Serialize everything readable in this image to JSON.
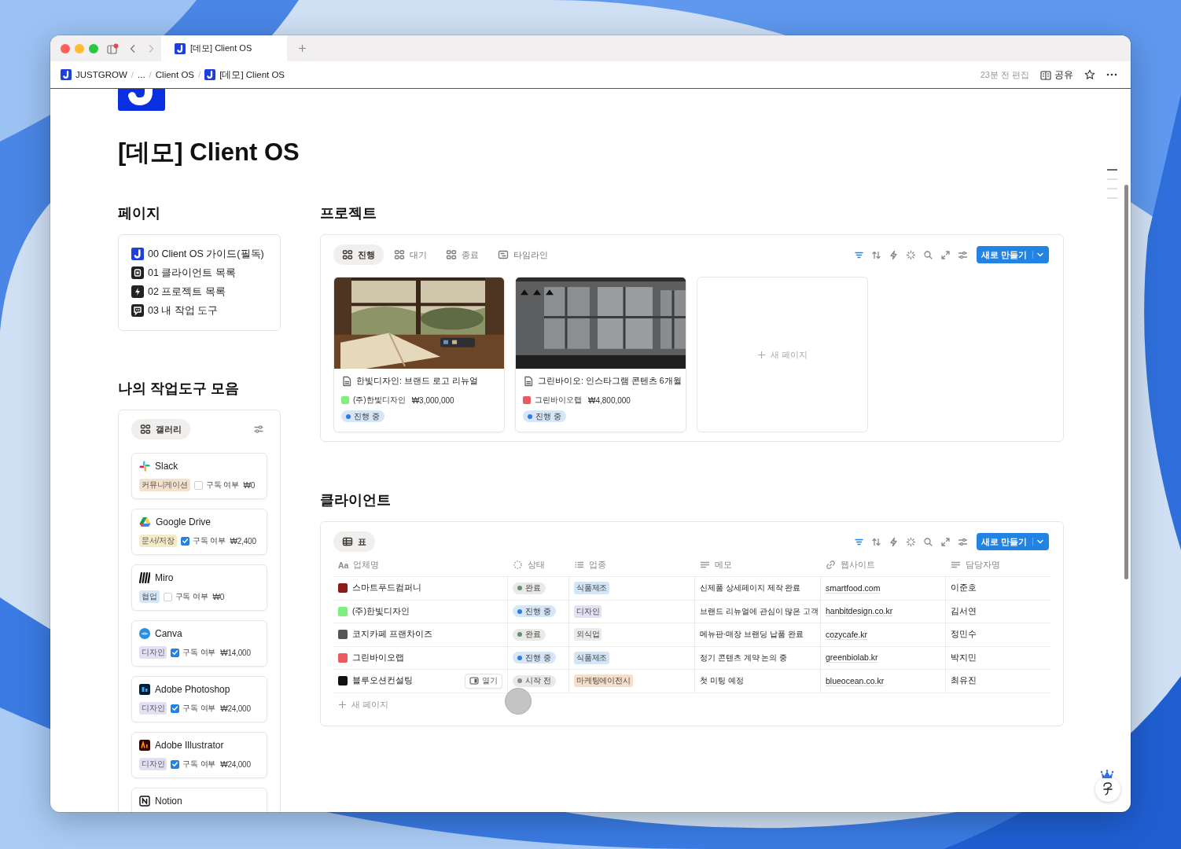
{
  "browser": {
    "tab_title": "[데모] Client OS"
  },
  "breadcrumbs": [
    {
      "label": "JUSTGROW",
      "kind": "logo"
    },
    {
      "label": "...",
      "kind": "text"
    },
    {
      "label": "Client OS",
      "kind": "text"
    },
    {
      "label": "[데모] Client OS",
      "kind": "logo"
    }
  ],
  "breadcrumb_separator": "/",
  "page_actions": {
    "edited": "23분 전 편집",
    "share": "공유"
  },
  "page": {
    "title": "[데모] Client OS"
  },
  "pages_section": {
    "heading": "페이지",
    "items": [
      {
        "label": "00 Client OS 가이드(필독)",
        "kind": "logo"
      },
      {
        "label": "01 클라이언트 목록",
        "kind": "copy"
      },
      {
        "label": "02 프로젝트 목록",
        "kind": "bolt"
      },
      {
        "label": "03 내 작업 도구",
        "kind": "chat"
      }
    ]
  },
  "tools_section": {
    "heading": "나의 작업도구 모음",
    "view_tab": "갤러리",
    "cards": [
      {
        "name": "Slack",
        "kind": "slack",
        "tag": "커뮤니케이션",
        "color": "#f4e1cc",
        "checked": false,
        "checkbox_label": "구독 여부",
        "price": "₩0"
      },
      {
        "name": "Google Drive",
        "kind": "gdrive",
        "tag": "문서/저장",
        "color": "#f5ebc9",
        "checked": true,
        "checkbox_label": "구독 여부",
        "price": "₩2,400"
      },
      {
        "name": "Miro",
        "kind": "miro",
        "tag": "협업",
        "color": "#d5e7f7",
        "checked": false,
        "checkbox_label": "구독 여부",
        "price": "₩0"
      },
      {
        "name": "Canva",
        "kind": "canva",
        "tag": "디자인",
        "color": "#e3e0f3",
        "checked": true,
        "checkbox_label": "구독 여부",
        "price": "₩14,000"
      },
      {
        "name": "Adobe Photoshop",
        "kind": "photoshop",
        "tag": "디자인",
        "color": "#e3e0f3",
        "checked": true,
        "checkbox_label": "구독 여부",
        "price": "₩24,000"
      },
      {
        "name": "Adobe Illustrator",
        "kind": "illustrator",
        "tag": "디자인",
        "color": "#e3e0f3",
        "checked": true,
        "checkbox_label": "구독 여부",
        "price": "₩24,000"
      },
      {
        "name": "Notion",
        "kind": "notion"
      }
    ]
  },
  "projects": {
    "heading": "프로젝트",
    "tabs": [
      {
        "label": "진행",
        "kind": "gallery",
        "selected": true
      },
      {
        "label": "대기",
        "kind": "gallery",
        "selected": false
      },
      {
        "label": "종료",
        "kind": "gallery",
        "selected": false
      },
      {
        "label": "타임라인",
        "kind": "timeline",
        "selected": false
      }
    ],
    "new_button": "새로 만들기",
    "cards": [
      {
        "title": "한빛디자인: 브랜드 로고 리뉴얼",
        "client": "(주)한빛디자인",
        "color": "#7ef07e",
        "amount": "₩3,000,000",
        "status": "진행 중"
      },
      {
        "title": "그린바이오: 인스타그램 콘텐츠 6개월",
        "client": "그린바이오랩",
        "color": "#ea5a5f",
        "amount": "₩4,800,000",
        "status": "진행 중"
      }
    ],
    "new_page": "새 페이지"
  },
  "clients": {
    "heading": "클라이언트",
    "view_tab": "표",
    "new_button": "새로 만들기",
    "columns": [
      {
        "label": "업체명",
        "kind": "title",
        "marker": "Aa"
      },
      {
        "label": "상태",
        "kind": "status"
      },
      {
        "label": "업종",
        "kind": "select"
      },
      {
        "label": "메모",
        "kind": "text"
      },
      {
        "label": "웹사이트",
        "kind": "url"
      },
      {
        "label": "담당자명",
        "kind": "text"
      }
    ],
    "rows": [
      {
        "name": "스마트푸드컴퍼니",
        "color": "#8e1b1b",
        "status": {
          "label": "완료",
          "kind": "done",
          "color": "#5f9070"
        },
        "industry": {
          "label": "식품제조",
          "color": "#d3e5f6"
        },
        "memo": "신제품 상세페이지 제작 완료",
        "website": "smartfood.com",
        "manager": "이준호"
      },
      {
        "name": "(주)한빛디자인",
        "color": "#7ef07e",
        "status": {
          "label": "진행 중",
          "kind": "in_progress",
          "color": "#2f7de1"
        },
        "industry": {
          "label": "디자인",
          "color": "#e4e0f3"
        },
        "memo": "브랜드 리뉴얼에 관심이 많은 고객",
        "website": "hanbitdesign.co.kr",
        "manager": "김서연"
      },
      {
        "name": "코지카페 프랜차이즈",
        "color": "#555555",
        "status": {
          "label": "완료",
          "kind": "done",
          "color": "#5f9070"
        },
        "industry": {
          "label": "외식업",
          "color": "#ebebea"
        },
        "memo": "메뉴판·매장 브랜딩 납품 완료",
        "website": "cozycafe.kr",
        "manager": "정민수"
      },
      {
        "name": "그린바이오랩",
        "color": "#ea5a5f",
        "status": {
          "label": "진행 중",
          "kind": "in_progress",
          "color": "#2f7de1"
        },
        "industry": {
          "label": "식품제조",
          "color": "#d3e5f6"
        },
        "memo": "정기 콘텐츠 계약 논의 중",
        "website": "greenbiolab.kr",
        "manager": "박지민"
      },
      {
        "name": "블루오션컨설팅",
        "color": "#111111",
        "open_button": "열기",
        "status": {
          "label": "시작 전",
          "kind": "not_started",
          "color": "#8d8d8a"
        },
        "industry": {
          "label": "마케팅에이전시",
          "color": "#f5dfca"
        },
        "memo": "첫 미팅 예정",
        "website": "blueocean.co.kr",
        "manager": "최유진"
      }
    ],
    "new_page": "새 페이지"
  }
}
